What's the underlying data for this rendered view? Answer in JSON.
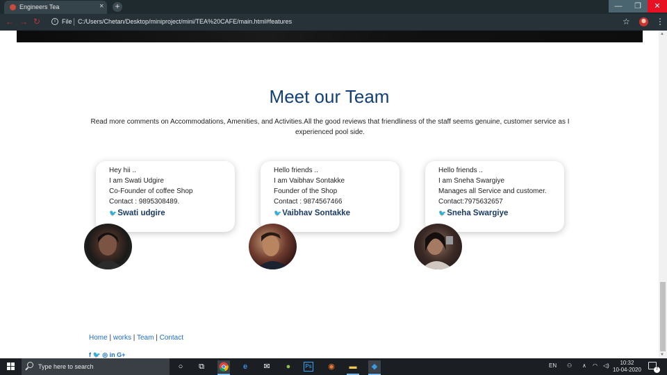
{
  "browser": {
    "tab_title": "Engineers Tea",
    "tab_close": "×",
    "new_tab": "+",
    "file_label": "File",
    "url": "C:/Users/Chetan/Desktop/miniproject/mini/TEA%20CAFE/main.html#features",
    "window_buttons": {
      "minimize": "—",
      "maximize": "❐",
      "close": "✕"
    }
  },
  "team": {
    "title": "Meet our Team",
    "description": "Read more comments on Accommodations, Amenities, and Activities.All the good reviews that friendliness of the staff seems genuine, customer service as I experienced pool side.",
    "members": [
      {
        "greeting": "Hey hii ..",
        "intro": "I am Swati Udgire",
        "role": "Co-Founder of coffee Shop",
        "contact": "Contact : 9895308489.",
        "handle": "Swati udgire"
      },
      {
        "greeting": "Hello friends ..",
        "intro": "I am Vaibhav Sontakke",
        "role": "Founder of the Shop",
        "contact": "Contact : 9874567466",
        "handle": "Vaibhav Sontakke"
      },
      {
        "greeting": "Hello friends ..",
        "intro": "I am Sneha Swargiye",
        "role": "Manages all Service and customer.",
        "contact": "Contact:7975632657",
        "handle": "Sneha Swargiye"
      }
    ]
  },
  "footer": {
    "links": [
      "Home",
      "works",
      "Team",
      "Contact"
    ],
    "separator": " | ",
    "social_icons": [
      "facebook-icon",
      "twitter-icon",
      "dribbble-icon",
      "linkedin-icon",
      "google-plus-icon"
    ]
  },
  "taskbar": {
    "search_placeholder": "Type here to search",
    "language": "EN",
    "time": "10:32",
    "date": "10-04-2020",
    "notification_count": "7"
  }
}
